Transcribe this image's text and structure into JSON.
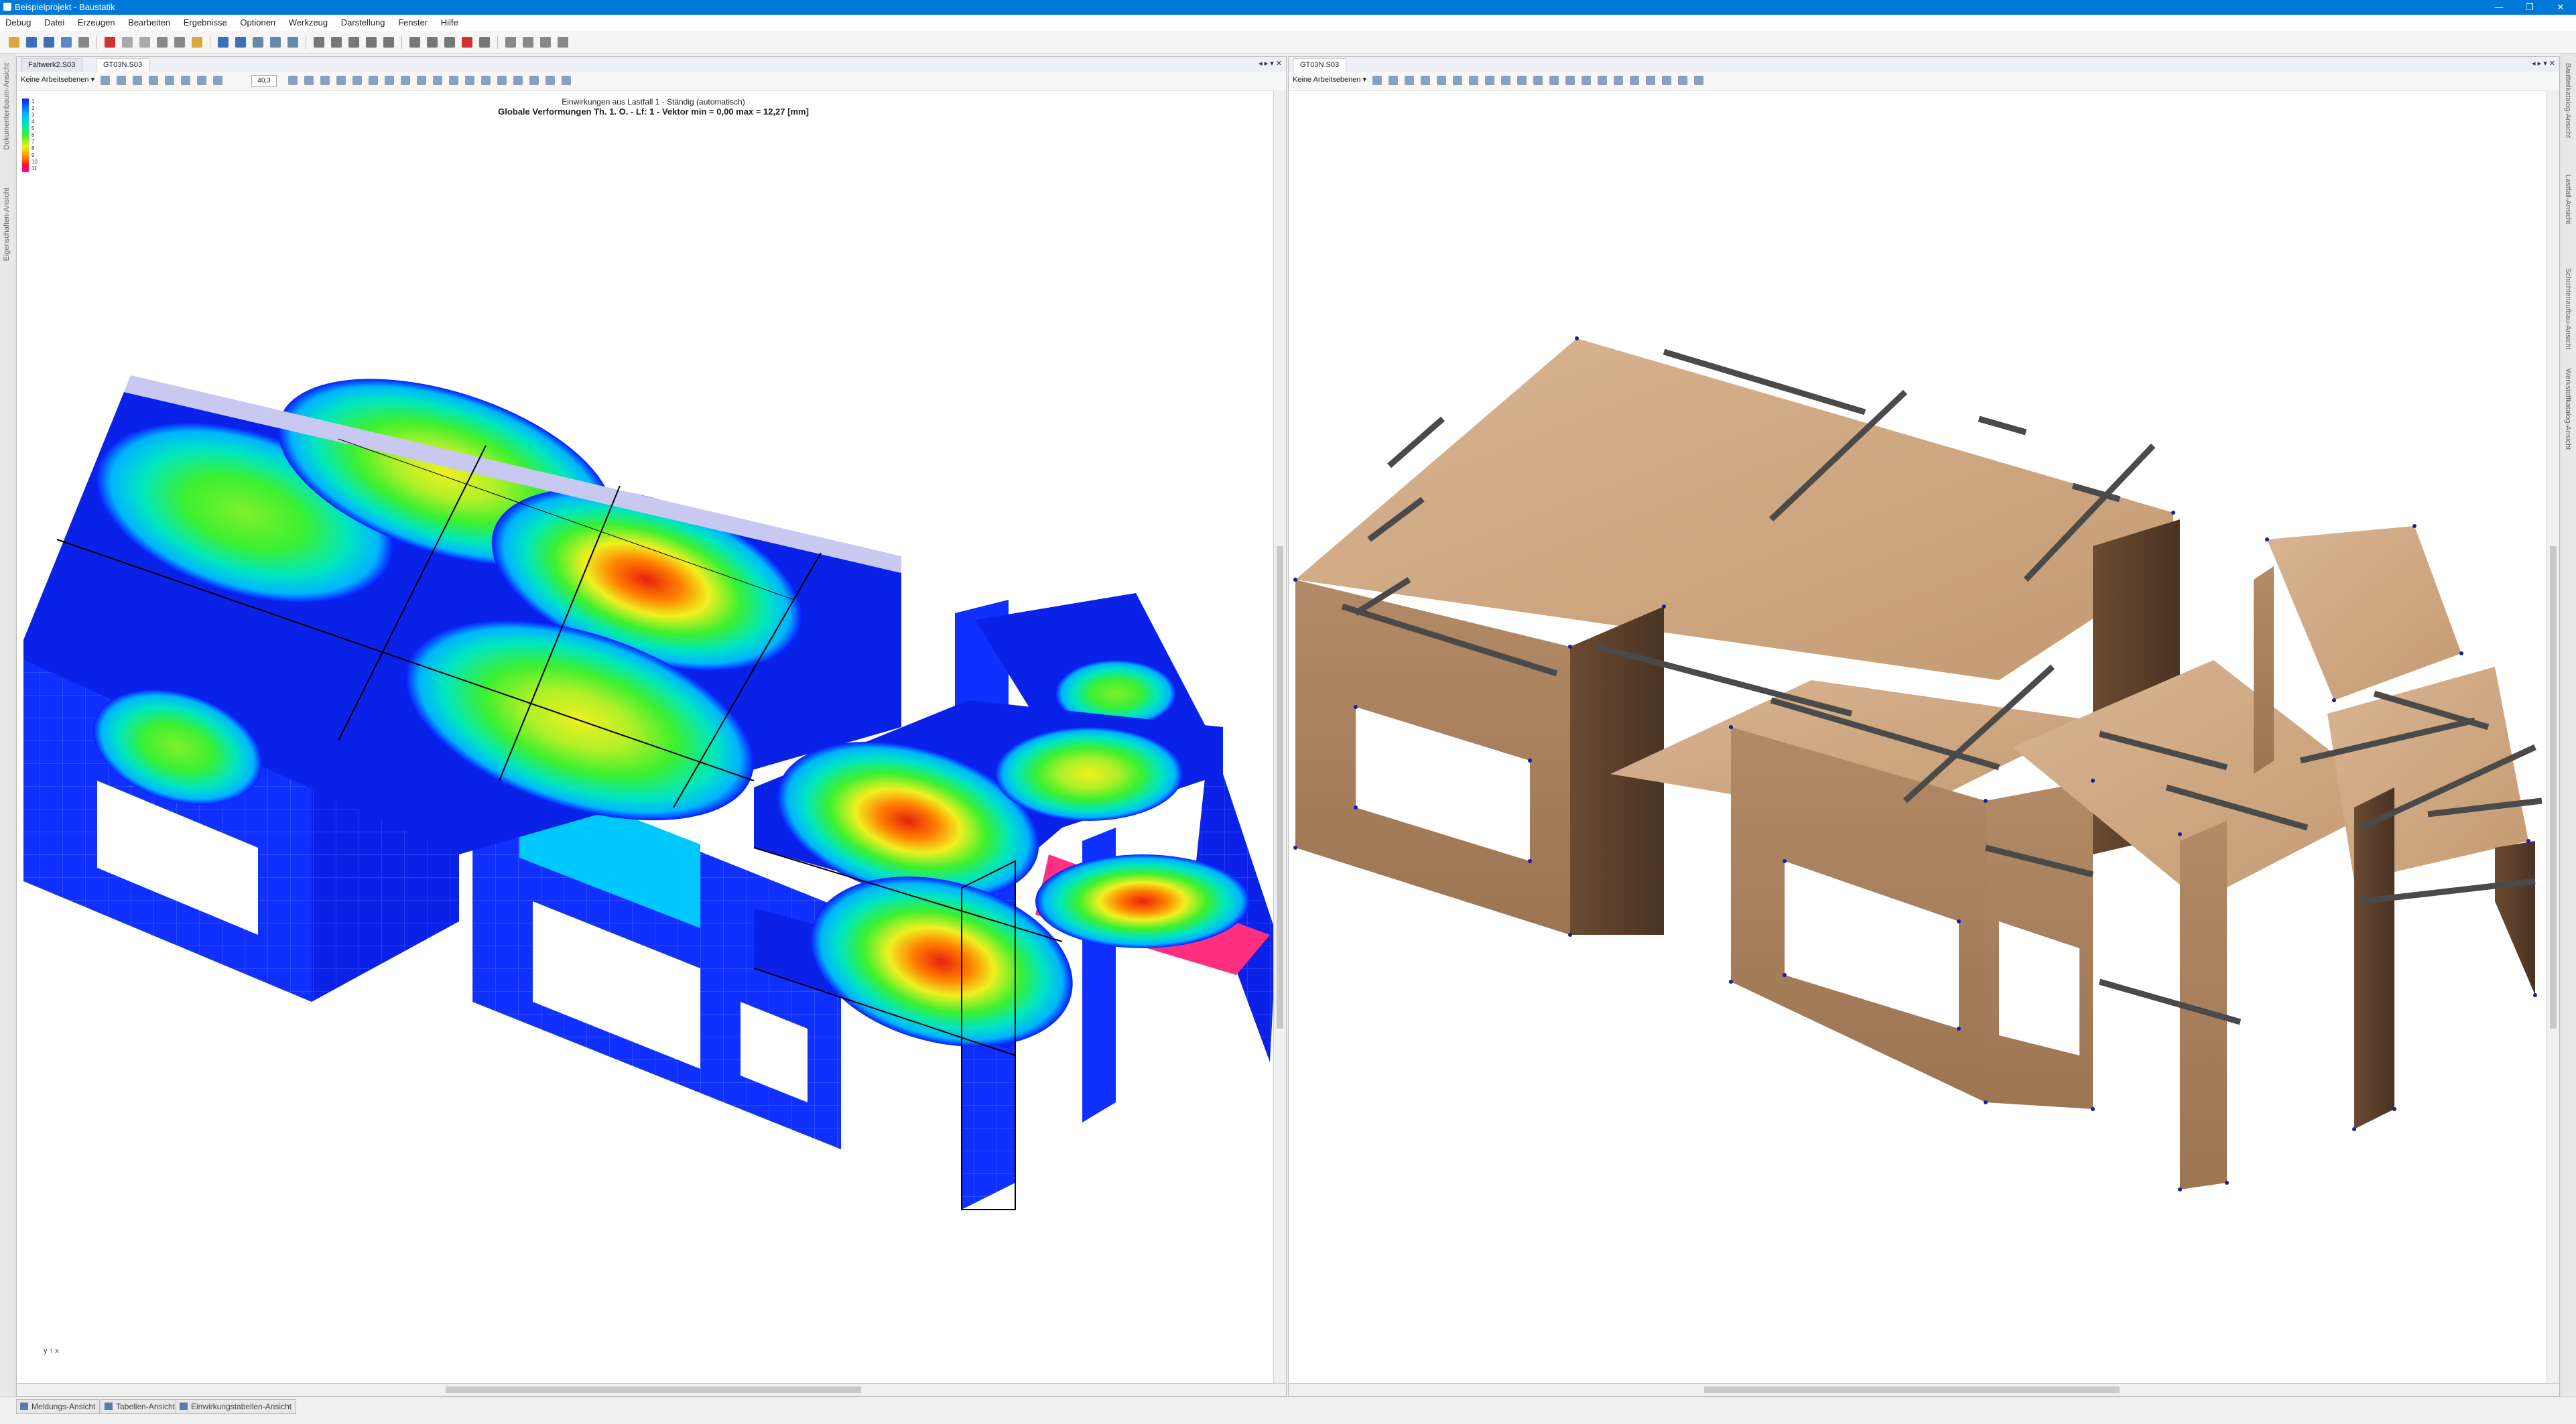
{
  "window": {
    "title": "Beispielprojekt - Baustatik",
    "controls": [
      "—",
      "❐",
      "✕"
    ]
  },
  "menu": [
    "Debug",
    "Datei",
    "Erzeugen",
    "Bearbeiten",
    "Ergebnisse",
    "Optionen",
    "Werkzeug",
    "Darstellung",
    "Fenster",
    "Hilfe"
  ],
  "left_strip": {
    "label1": "Dokumentenbaum-Ansicht",
    "label2": "Eigenschaften-Ansicht"
  },
  "right_strip": {
    "label1": "Bautteilkatalog-Ansicht",
    "label2": "Lastfall-Ansicht",
    "label3": "Schichtenaufbau-Ansicht",
    "label4": "Werkstoffkatalog-Ansicht"
  },
  "pane_left": {
    "tabs": [
      "Faltwerk2.S03",
      "GT03N.S03"
    ],
    "active_tab": 1,
    "tab_controls": "◂ ▸ ▾ ✕",
    "layer_select": "Keine Arbeitsebenen ▾",
    "zoom_value": "40,3",
    "caption_line1": "Einwirkungen aus Lastfall 1 - Ständig (automatisch)",
    "caption_line2": "Globale Verformungen Th. 1. O. - Lf: 1 - Vektor min = 0,00 max = 12,27 [mm]",
    "legend_labels": [
      "1",
      "2",
      "3",
      "4",
      "5",
      "6",
      "7",
      "8",
      "9",
      "10",
      "11",
      "12"
    ],
    "axis_glyph": "y ↑ x"
  },
  "pane_right": {
    "tabs": [
      "GT03N.S03"
    ],
    "tab_controls": "◂ ▸ ▾ ✕",
    "layer_select": "Keine Arbeitsebenen ▾"
  },
  "status_tabs": [
    "Meldungs-Ansicht",
    "Tabellen-Ansicht",
    "Einwirkungstabellen-Ansicht"
  ],
  "colors": {
    "titlebar": "#0078d7",
    "contour_min": "#0a1cff",
    "contour_max": "#e82010",
    "wood": "#c9a07a",
    "beam": "#4a4a4a"
  }
}
